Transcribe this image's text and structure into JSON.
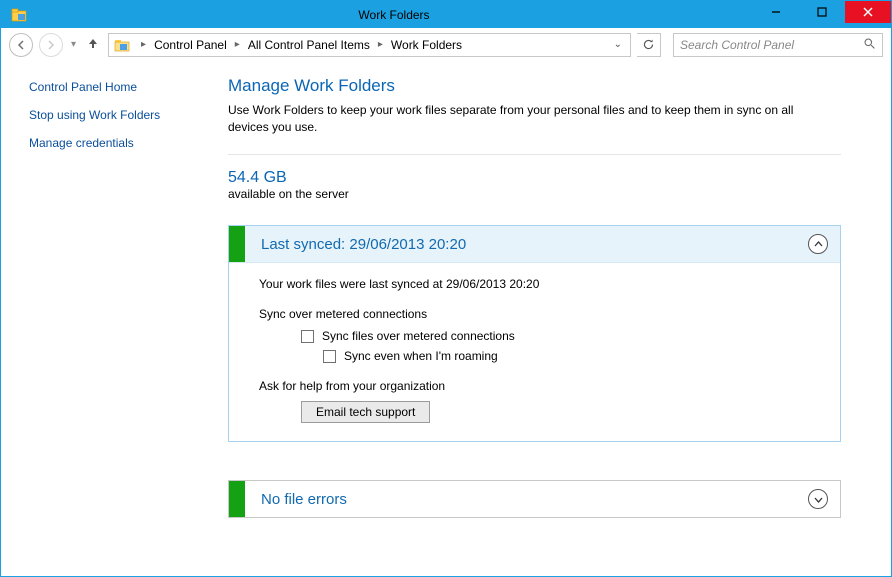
{
  "window": {
    "title": "Work Folders"
  },
  "breadcrumb": {
    "items": [
      "Control Panel",
      "All Control Panel Items",
      "Work Folders"
    ]
  },
  "search": {
    "placeholder": "Search Control Panel"
  },
  "sidebar": {
    "home": "Control Panel Home",
    "stop": "Stop using Work Folders",
    "creds": "Manage credentials"
  },
  "main": {
    "heading": "Manage Work Folders",
    "description": "Use Work Folders to keep your work files separate from your personal files and to keep them in sync on all devices you use.",
    "storage_value": "54.4 GB",
    "storage_sub": "available on the server"
  },
  "sync_panel": {
    "title": "Last synced: 29/06/2013 20:20",
    "body_line": "Your work files were last synced at 29/06/2013 20:20",
    "metered_title": "Sync over metered connections",
    "metered_check": "Sync files over metered connections",
    "roaming_check": "Sync even when I'm roaming",
    "help_title": "Ask for help from your organization",
    "help_button": "Email tech support"
  },
  "errors_panel": {
    "title": "No file errors"
  }
}
